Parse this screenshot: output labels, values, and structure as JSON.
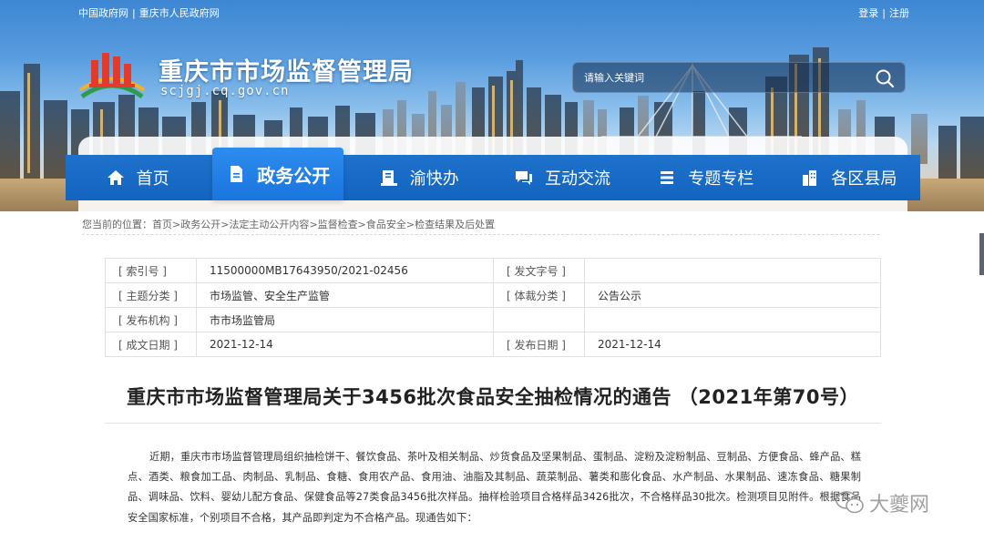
{
  "top_links": {
    "left": [
      "中国政府网",
      "重庆市人民政府网"
    ],
    "right": [
      "登录",
      "注册"
    ],
    "separator": "|"
  },
  "site": {
    "name": "重庆市市场监督管理局",
    "domain": "scjgj.cq.gov.cn"
  },
  "search": {
    "placeholder": "请输入关键词",
    "icon": "search-icon"
  },
  "nav": {
    "items": [
      {
        "label": "首页",
        "icon": "home-icon"
      },
      {
        "label": "政务公开",
        "icon": "document-icon",
        "active": true
      },
      {
        "label": "渝快办",
        "icon": "service-icon"
      },
      {
        "label": "互动交流",
        "icon": "chat-icon"
      },
      {
        "label": "专题专栏",
        "icon": "list-icon"
      },
      {
        "label": "各区县局",
        "icon": "building-icon"
      }
    ]
  },
  "breadcrumb": {
    "prefix": "您当前的位置：",
    "items": [
      "首页",
      "政务公开",
      "法定主动公开内容",
      "监督检查",
      "食品安全",
      "检查结果及后处置"
    ],
    "separator": ">"
  },
  "meta": {
    "rows": [
      {
        "label1": "[ 索引号 ]",
        "value1": "11500000MB17643950/2021-02456",
        "label2": "[ 发文字号 ]",
        "value2": ""
      },
      {
        "label1": "[ 主题分类 ]",
        "value1": "市场监管、安全生产监管",
        "label2": "[ 体裁分类 ]",
        "value2": "公告公示"
      },
      {
        "label1": "[ 发布机构 ]",
        "value1": "市市场监管局",
        "label2": "",
        "value2": ""
      },
      {
        "label1": "[ 成文日期 ]",
        "value1": "2021-12-14",
        "label2": "[ 发布日期 ]",
        "value2": "2021-12-14"
      }
    ]
  },
  "article": {
    "title": "重庆市市场监督管理局关于3456批次食品安全抽检情况的通告 （2021年第70号）",
    "body": "近期，重庆市市场监督管理局组织抽检饼干、餐饮食品、茶叶及相关制品、炒货食品及坚果制品、蛋制品、淀粉及淀粉制品、豆制品、方便食品、蜂产品、糕点、酒类、粮食加工品、肉制品、乳制品、食糖、食用农产品、食用油、油脂及其制品、蔬菜制品、薯类和膨化食品、水产制品、水果制品、速冻食品、糖果制品、调味品、饮料、婴幼儿配方食品、保健食品等27类食品3456批次样品。抽样检验项目合格样品3426批次，不合格样品30批次。检测项目见附件。根据食品安全国家标准，个别项目不合格，其产品即判定为不合格产品。现通告如下："
  },
  "watermark": {
    "text": "大夔网",
    "icon": "wechat-icon"
  },
  "colors": {
    "nav_blue": "#1264bf",
    "nav_active": "#2d8cf0",
    "sky": "#5a9ee0"
  }
}
